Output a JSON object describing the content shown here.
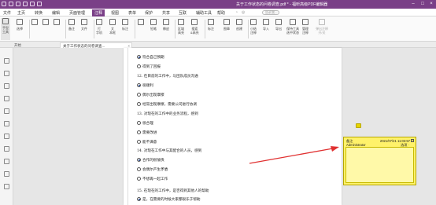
{
  "window": {
    "title": "关于工作状态的问卷调查.pdf * - 福昕高级PDF编辑器"
  },
  "menu": {
    "items": [
      "文件",
      "主页",
      "转换",
      "编辑",
      "页面管理",
      "注释",
      "视图",
      "表单",
      "保护",
      "共享",
      "互联",
      "辅助工具",
      "帮助"
    ],
    "active": "注释",
    "search_placeholder": "告诉我..."
  },
  "ribbon": {
    "buttons": [
      {
        "label": "手型",
        "label2": "工具"
      },
      {
        "label": "选择",
        "label2": ""
      },
      {
        "label": "",
        "label2": ""
      },
      {
        "label": "",
        "label2": ""
      },
      {
        "label": "",
        "label2": ""
      },
      {
        "label": "备注",
        "label2": ""
      },
      {
        "label": "文件",
        "label2": ""
      },
      {
        "label": "打",
        "label2": "字机"
      },
      {
        "label": "文",
        "label2": "本框"
      },
      {
        "label": "标注",
        "label2": ""
      },
      {
        "label": "",
        "label2": ""
      },
      {
        "label": "铅笔",
        "label2": ""
      },
      {
        "label": "橡皮",
        "label2": ""
      },
      {
        "label": "区域",
        "label2": "高亮"
      },
      {
        "label": "搜索",
        "label2": "&高亮"
      },
      {
        "label": "标注",
        "label2": ""
      },
      {
        "label": "图章",
        "label2": ""
      },
      {
        "label": "创建",
        "label2": ""
      },
      {
        "label": "小结",
        "label2": "注释"
      },
      {
        "label": "导入",
        "label2": ""
      },
      {
        "label": "导出",
        "label2": ""
      },
      {
        "label": "保持工具",
        "label2": "选中状态"
      },
      {
        "label": "管理",
        "label2": "注释"
      },
      {
        "label": "弹出注释",
        "label2": "开/关"
      }
    ]
  },
  "tabs": {
    "inactive": "开始",
    "active": "关于工作状态的问卷调查...",
    "close": "×"
  },
  "document": {
    "lines": [
      {
        "kind": "opt",
        "radio": "on",
        "text": "符合自己预期"
      },
      {
        "kind": "opt",
        "radio": "off",
        "text": "得到了回报"
      },
      {
        "kind": "q",
        "text": "12. 在目前的工作中，与团队成员沟通"
      },
      {
        "kind": "opt",
        "radio": "on",
        "text": "很顺利"
      },
      {
        "kind": "opt",
        "radio": "off",
        "text": "偶尔出现摩擦"
      },
      {
        "kind": "opt",
        "radio": "off",
        "text": "经常出现摩擦，需要公司进行协调"
      },
      {
        "kind": "q",
        "text": "13. 对现在的工作中的业务流程，感到"
      },
      {
        "kind": "opt",
        "radio": "off",
        "text": "很合理"
      },
      {
        "kind": "opt",
        "radio": "off",
        "text": "需要改进"
      },
      {
        "kind": "opt",
        "radio": "off",
        "text": "能不满意"
      },
      {
        "kind": "q",
        "text": "14. 对现在工作中与其配合的人员，感到"
      },
      {
        "kind": "opt",
        "radio": "on",
        "text": "合作的很愉快"
      },
      {
        "kind": "opt",
        "radio": "off",
        "text": "会偶尔产生矛盾"
      },
      {
        "kind": "opt",
        "radio": "off",
        "text": "不想再一起工作"
      },
      {
        "kind": "q",
        "text": ""
      },
      {
        "kind": "q",
        "text": "15. 在现在的工作中，是否得到其他人的帮助"
      },
      {
        "kind": "opt",
        "radio": "on",
        "text": "是，在需要的时候大家都很乐于帮助"
      }
    ]
  },
  "note_popup": {
    "title": "备注",
    "author": "Administrator",
    "date": "2021/07/21 11:03:57",
    "options": "选项 ·",
    "close": "×",
    "body": ""
  },
  "colors": {
    "titlebar": "#7a3f87",
    "note_fill": "#fff26a",
    "arrow": "#e03030"
  }
}
